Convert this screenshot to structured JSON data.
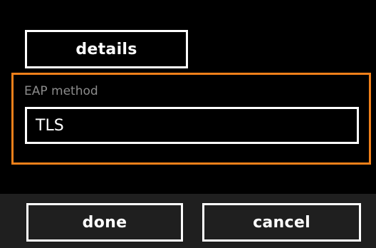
{
  "details_button": {
    "label": "details"
  },
  "eap": {
    "label": "EAP method",
    "value": "TLS"
  },
  "app_bar": {
    "done_label": "done",
    "cancel_label": "cancel"
  },
  "colors": {
    "background": "#000000",
    "accent": "#f0801a",
    "foreground": "#ffffff",
    "label_gray": "#8c8c8c",
    "app_bar": "#1f1f1f"
  }
}
